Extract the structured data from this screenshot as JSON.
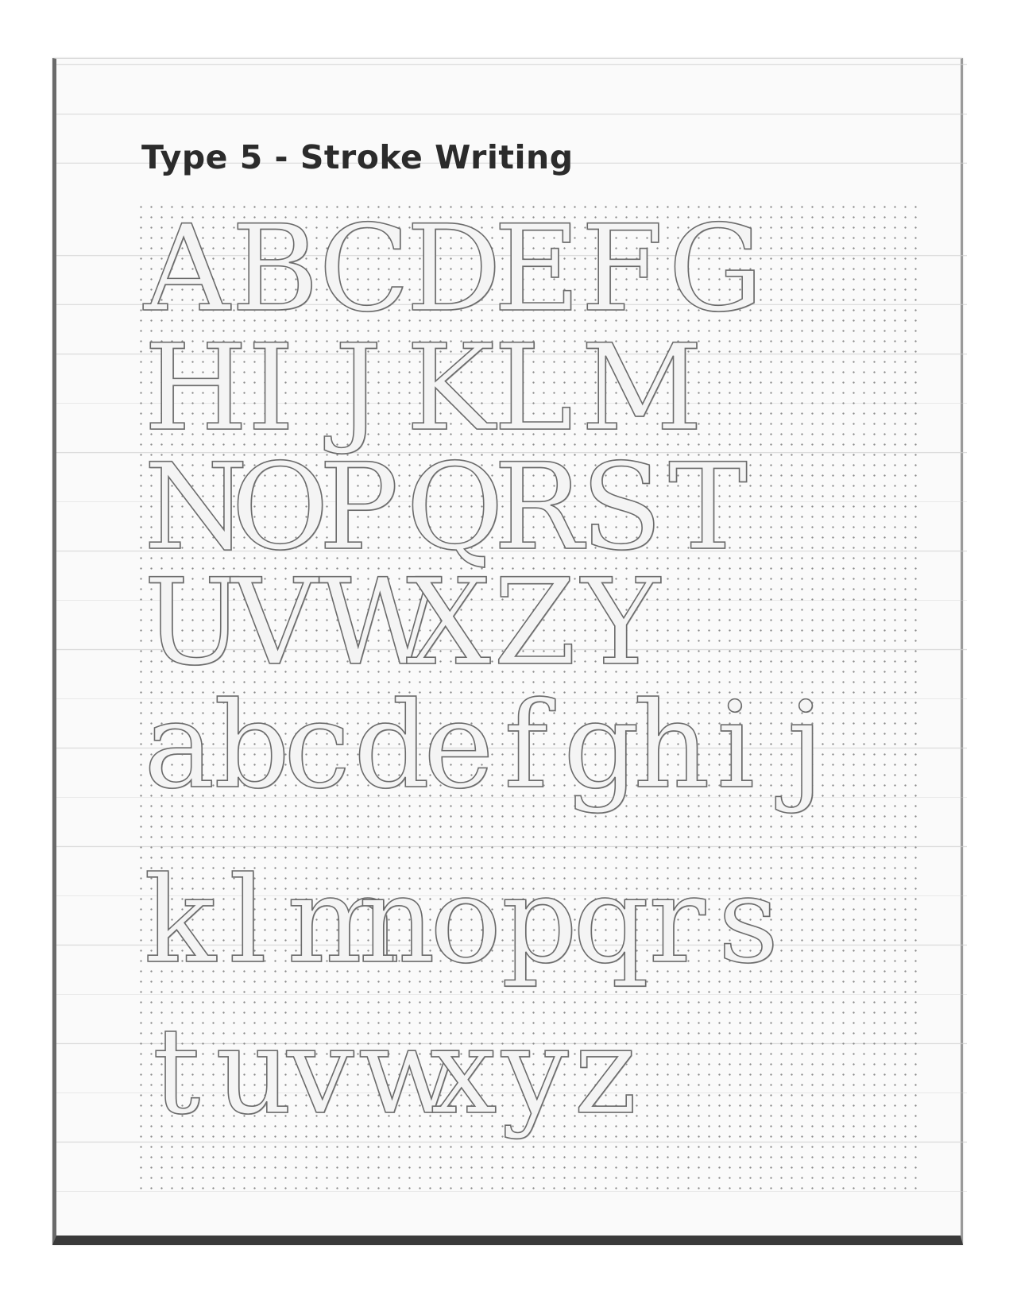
{
  "title": "Type 5 - Stroke Writing",
  "alphabet": {
    "rows": [
      {
        "kind": "upper",
        "letters": [
          "A",
          "B",
          "C",
          "D",
          "E",
          "F",
          "G"
        ]
      },
      {
        "kind": "upper",
        "letters": [
          "H",
          "I",
          "J",
          "K",
          "L",
          "M"
        ]
      },
      {
        "kind": "upper",
        "letters": [
          "N",
          "O",
          "P",
          "Q",
          "R",
          "S",
          "T"
        ]
      },
      {
        "kind": "upper",
        "letters": [
          "U",
          "V",
          "W",
          "X",
          "Z",
          "Y"
        ]
      },
      {
        "kind": "lower",
        "letters": [
          "a",
          "b",
          "c",
          "d",
          "e",
          "f",
          "g",
          "h",
          "i",
          "j"
        ]
      },
      {
        "kind": "lower",
        "letters": [
          "k",
          "l",
          "m",
          "n",
          "o",
          "p",
          "q",
          "r",
          "s"
        ]
      },
      {
        "kind": "lower",
        "letters": [
          "t",
          "u",
          "v",
          "w",
          "x",
          "y",
          "z"
        ]
      }
    ]
  }
}
